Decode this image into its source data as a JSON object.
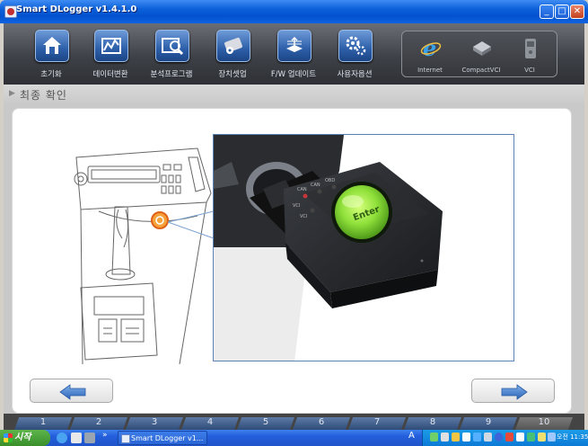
{
  "window": {
    "title": "Smart DLogger v1.4.1.0",
    "controls": {
      "minimize": "_",
      "maximize": "□",
      "close": "✕"
    }
  },
  "toolbar": {
    "buttons": [
      {
        "id": "home",
        "label": "초기화",
        "icon": "home-icon"
      },
      {
        "id": "data-convert",
        "label": "데이터변환",
        "icon": "data-convert-icon"
      },
      {
        "id": "analysis",
        "label": "분석프로그램",
        "icon": "analysis-icon"
      },
      {
        "id": "device-settings",
        "label": "장치셋업",
        "icon": "device-settings-icon"
      },
      {
        "id": "fw-update",
        "label": "F/W 업데이트",
        "icon": "firmware-update-icon"
      },
      {
        "id": "user-options",
        "label": "사용자옵션",
        "icon": "gear-icon"
      }
    ],
    "right": [
      {
        "id": "internet",
        "label": "Internet",
        "icon": "internet-explorer-icon"
      },
      {
        "id": "compactvci",
        "label": "CompactVCI",
        "icon": "compactvci-icon"
      },
      {
        "id": "vci",
        "label": "VCI",
        "icon": "vci-icon"
      }
    ]
  },
  "breadcrumb": {
    "arrow": "▶",
    "text": "최종 확인"
  },
  "device": {
    "button_label": "Enter",
    "leds": [
      "CAN",
      "CAN",
      "OBD",
      "VCI",
      "VCI"
    ]
  },
  "navigation": {
    "prev_icon": "arrow-left-icon",
    "next_icon": "arrow-right-icon"
  },
  "steps": [
    {
      "label": "1",
      "active": true
    },
    {
      "label": "2",
      "active": true
    },
    {
      "label": "3",
      "active": true
    },
    {
      "label": "4",
      "active": true
    },
    {
      "label": "5",
      "active": true
    },
    {
      "label": "6",
      "active": true
    },
    {
      "label": "7",
      "active": true
    },
    {
      "label": "8",
      "active": true
    },
    {
      "label": "9",
      "active": true
    },
    {
      "label": "10",
      "active": false
    }
  ],
  "taskbar": {
    "start_label": "시작",
    "task_item": "Smart DLogger v1...",
    "ime": "A",
    "clock": "오전 11:35",
    "chevron": "»"
  },
  "colors": {
    "accent": "#2d5fa9",
    "panel_bg": "#ffffff",
    "frame": "#5b83b8",
    "led_green": "#8fe03a"
  }
}
